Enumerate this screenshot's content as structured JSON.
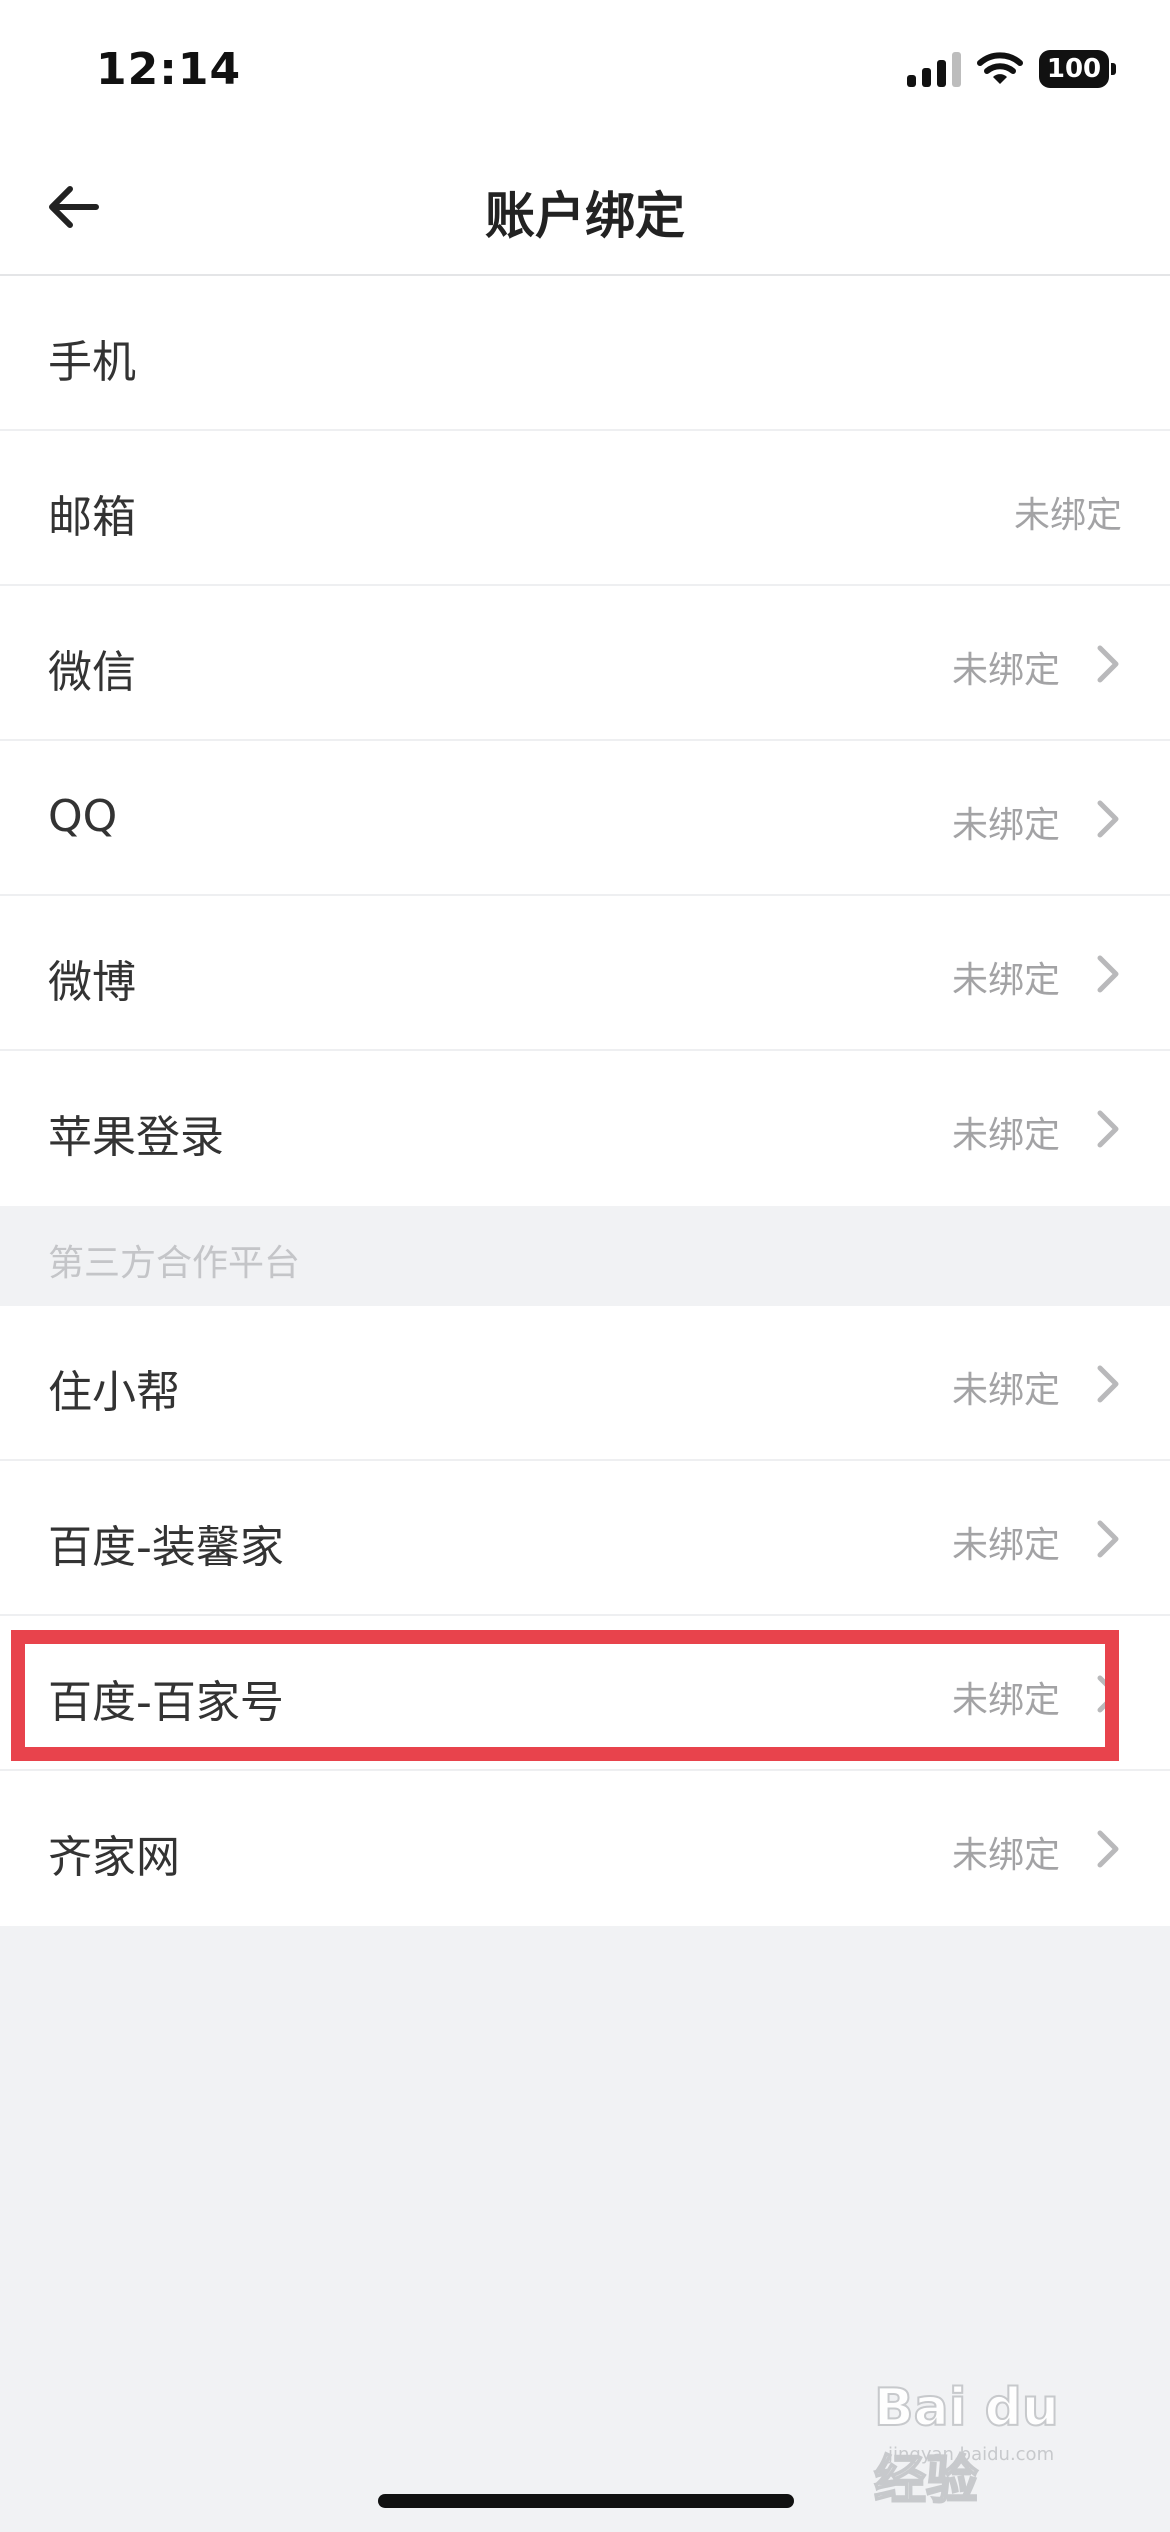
{
  "status_bar": {
    "time": "12:14",
    "battery": "100"
  },
  "nav": {
    "title": "账户绑定",
    "back_icon": "arrow-left-icon"
  },
  "accounts": [
    {
      "label": "手机",
      "value": "",
      "arrow": false
    },
    {
      "label": "邮箱",
      "value": "未绑定",
      "arrow": false
    },
    {
      "label": "微信",
      "value": "未绑定",
      "arrow": true
    },
    {
      "label": "QQ",
      "value": "未绑定",
      "arrow": true
    },
    {
      "label": "微博",
      "value": "未绑定",
      "arrow": true
    },
    {
      "label": "苹果登录",
      "value": "未绑定",
      "arrow": true
    }
  ],
  "third_party": {
    "section_label": "第三方合作平台",
    "items": [
      {
        "label": "住小帮",
        "value": "未绑定",
        "arrow": true
      },
      {
        "label": "百度-装馨家",
        "value": "未绑定",
        "arrow": true
      },
      {
        "label": "百度-百家号",
        "value": "未绑定",
        "arrow": true
      },
      {
        "label": "齐家网",
        "value": "未绑定",
        "arrow": true
      }
    ]
  },
  "highlight_color": "#e8434c",
  "watermark": {
    "brand": "Bai du 经验",
    "url": "jingyan.baidu.com"
  }
}
